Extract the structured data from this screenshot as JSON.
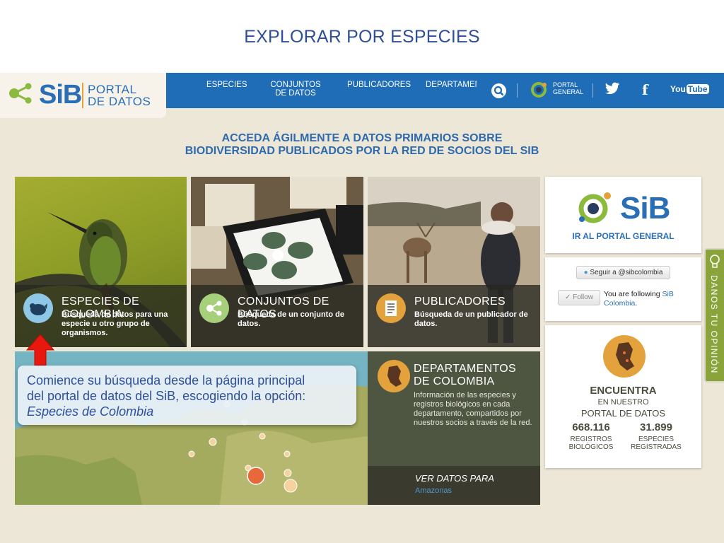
{
  "slide": {
    "title": "EXPLORAR POR ESPECIES"
  },
  "header": {
    "logo_text": "SiB",
    "logo_portal_line1": "PORTAL",
    "logo_portal_line2": "DE DATOS",
    "nav": [
      {
        "label": "ESPECIES"
      },
      {
        "label": "CONJUNTOS DE DATOS"
      },
      {
        "label": "PUBLICADORES"
      },
      {
        "label": "DEPARTAMEN"
      }
    ],
    "portal_general_line1": "PORTAL",
    "portal_general_line2": "GENERAL",
    "youtube_label_a": "You",
    "youtube_label_b": "Tube",
    "facebook_glyph": "f",
    "accent_color": "#1f6db6"
  },
  "headline": {
    "line1": "ACCEDA ÁGILMENTE A DATOS PRIMARIOS SOBRE",
    "line2": "BIODIVERSIDAD PUBLICADOS POR LA RED DE SOCIOS DEL SIB"
  },
  "tiles": [
    {
      "title": "ESPECIES DE COLOMBIA",
      "description": "Búsqueda de datos para una especie u otro grupo de organismos."
    },
    {
      "title": "CONJUNTOS DE DATOS",
      "description": "Búsqueda de un conjunto de datos."
    },
    {
      "title": "PUBLICADORES",
      "description": "Búsqueda de un publicador de datos."
    }
  ],
  "departamentos": {
    "title": "DEPARTAMENTOS DE COLOMBIA",
    "description": "Información de las especies y registros biológicos en cada departamento, compartidos por nuestros socios a través de la red.",
    "cta": "VER DATOS PARA",
    "selected": "Amazonas"
  },
  "sidebar": {
    "logo_text": "SiB",
    "portal_link": "IR AL PORTAL GENERAL",
    "twitter_button": "Seguir a @sibcolombia",
    "follow_button": "Follow",
    "following_prefix": "You are following",
    "following_name": "SiB Colombia",
    "following_suffix": ".",
    "encuentra_title": "ENCUENTRA",
    "encuentra_sub1": "EN NUESTRO",
    "encuentra_sub2": "PORTAL DE DATOS",
    "stats": [
      {
        "value": "668.116",
        "label1": "REGISTROS",
        "label2": "BIOLÓGICOS"
      },
      {
        "value": "31.899",
        "label1": "ESPECIES",
        "label2": "REGISTRADAS"
      }
    ]
  },
  "feedback_tab": "DANOS TU OPINIÓN",
  "callout": {
    "line1": "Comience su búsqueda desde la página principal",
    "line2": "del portal de datos del SiB, escogiendo la opción:",
    "emphasis": "Especies de Colombia"
  }
}
